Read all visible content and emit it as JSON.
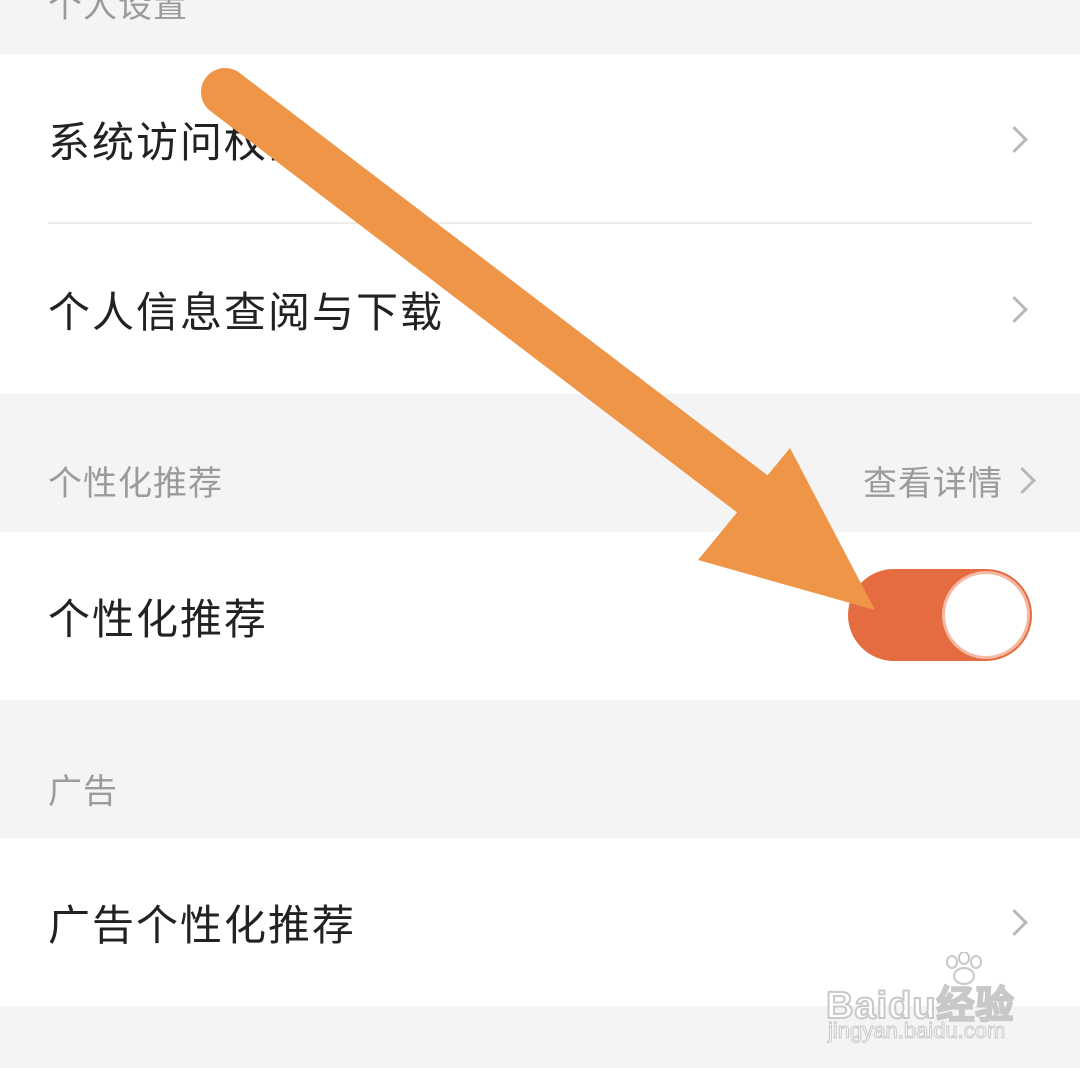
{
  "sections": {
    "personal_settings": {
      "header": "个人设置",
      "items": [
        {
          "label": "系统访问权限"
        },
        {
          "label": "个人信息查阅与下载"
        }
      ]
    },
    "personalized_recommendation": {
      "header": "个性化推荐",
      "details_link": "查看详情",
      "toggle_item": {
        "label": "个性化推荐",
        "enabled": true
      }
    },
    "ads": {
      "header": "广告",
      "items": [
        {
          "label": "广告个性化推荐"
        }
      ]
    }
  },
  "watermark": {
    "brand": "Baidu经验",
    "url": "jingyan.baidu.com"
  },
  "colors": {
    "toggle_on": "#e56b40",
    "annotation_arrow": "#ef9548",
    "section_bg": "#f4f4f4",
    "card_bg": "#ffffff"
  },
  "icons": {
    "row_chevron": "chevron-right-icon",
    "annotation": "arrow-annotation-icon"
  }
}
